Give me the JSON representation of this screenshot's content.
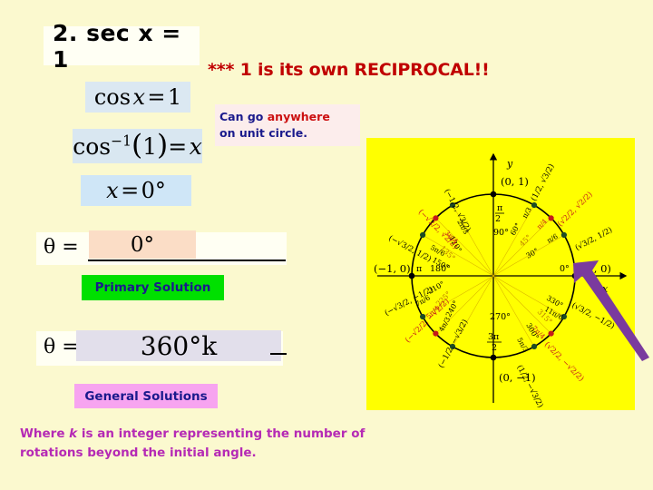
{
  "slide": {
    "background_color": "#fbf9cf",
    "problem": {
      "number": "2.",
      "text": "2.  sec x = 1"
    },
    "equations": [
      {
        "id": "cos",
        "text": "cos x = 1",
        "highlight_color": "#dbe8f2"
      },
      {
        "id": "arccos",
        "text": "cos⁻¹(1) = x",
        "highlight_color": "#d9e7f1"
      },
      {
        "id": "x0",
        "text": "x = 0°",
        "highlight_color": "#cfe6f7"
      }
    ],
    "reciprocal_note": "*** 1 is its own RECIPROCAL!!",
    "anywhere_note": {
      "line1_part1": "Can go ",
      "line1_emphasis": "anywhere",
      "line2": "on unit circle.",
      "emphasis_color": "#cc1111",
      "text_color": "#1a1a8c"
    },
    "primary": {
      "theta_symbol": "θ  =",
      "value": "0°",
      "label": "Primary Solution",
      "label_bg": "#00e000"
    },
    "general": {
      "theta_symbol": "θ  =",
      "value": "360°k",
      "label": "General Solutions",
      "label_bg": "#f7a4f0"
    },
    "footnote": {
      "part1": "Where ",
      "k": "k",
      "part2": " is an integer representing the number of rotations beyond the initial angle.",
      "color": "#b52ab5"
    }
  },
  "unit_circle": {
    "background_color": "#ffff00",
    "axis_labels": {
      "x": "x",
      "y": "y"
    },
    "quadrant_points": [
      {
        "angle_deg": "0°",
        "radians": "0",
        "coords": "(1, 0)"
      },
      {
        "angle_deg": "30°",
        "radians": "π/6",
        "coords": "(√3/2, 1/2)"
      },
      {
        "angle_deg": "45°",
        "radians": "π/4",
        "coords": "(√2/2, √2/2)"
      },
      {
        "angle_deg": "60°",
        "radians": "π/3",
        "coords": "(1/2, √3/2)"
      },
      {
        "angle_deg": "90°",
        "radians": "π/2",
        "coords": "(0, 1)"
      },
      {
        "angle_deg": "120°",
        "radians": "2π/3",
        "coords": "(-1/2, √3/2)"
      },
      {
        "angle_deg": "135°",
        "radians": "3π/4",
        "coords": "(-√2/2, √2/2)"
      },
      {
        "angle_deg": "150°",
        "radians": "5π/6",
        "coords": "(-√3/2, 1/2)"
      },
      {
        "angle_deg": "180°",
        "radians": "π",
        "coords": "(-1, 0)"
      },
      {
        "angle_deg": "210°",
        "radians": "7π/6",
        "coords": "(-√3/2, -1/2)"
      },
      {
        "angle_deg": "225°",
        "radians": "5π/4",
        "coords": "(-√2/2, -√2/2)"
      },
      {
        "angle_deg": "240°",
        "radians": "4π/3",
        "coords": "(-1/2, -√3/2)"
      },
      {
        "angle_deg": "270°",
        "radians": "3π/2",
        "coords": "(0, -1)"
      },
      {
        "angle_deg": "300°",
        "radians": "5π/3",
        "coords": "(1/2, -√3/2)"
      },
      {
        "angle_deg": "315°",
        "radians": "7π/4",
        "coords": "(√2/2, -√2/2)"
      },
      {
        "angle_deg": "330°",
        "radians": "11π/6",
        "coords": "(√3/2, -1/2)"
      }
    ],
    "pointer_arrow": {
      "color": "#7a3a9e",
      "points_to": "(1, 0)"
    }
  }
}
